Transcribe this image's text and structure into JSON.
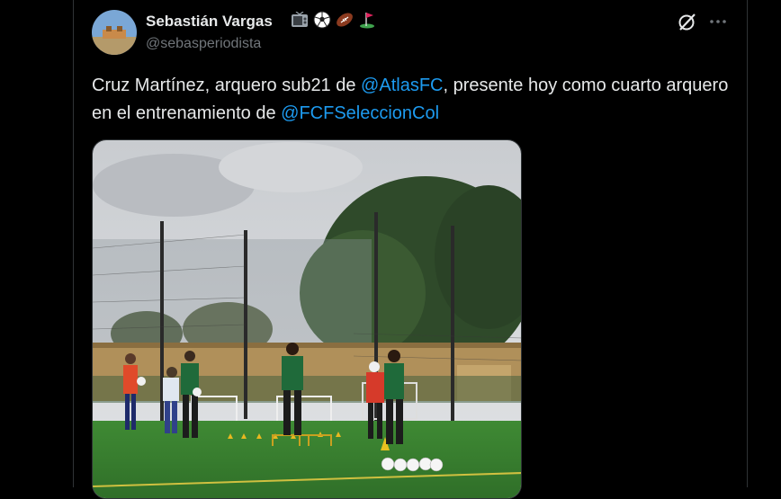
{
  "author": {
    "name": "Sebastián Vargas",
    "handle": "@sebasperiodista",
    "badges": [
      "tv-icon",
      "soccer-ball-icon",
      "american-football-icon",
      "golf-flag-icon"
    ]
  },
  "header_actions": {
    "grok_icon": "grok-icon",
    "more_icon": "more-icon"
  },
  "tweet": {
    "text_part1": "Cruz Martínez, arquero sub21 de ",
    "mention1": "@AtlasFC",
    "text_part2": ", presente hoy como cuarto arquero en el entrenamiento de ",
    "mention2": "@FCFSeleccionCol"
  },
  "colors": {
    "background": "#000000",
    "text": "#e7e9ea",
    "secondary": "#71767b",
    "link": "#1d9bf0",
    "border": "#2f3336"
  }
}
